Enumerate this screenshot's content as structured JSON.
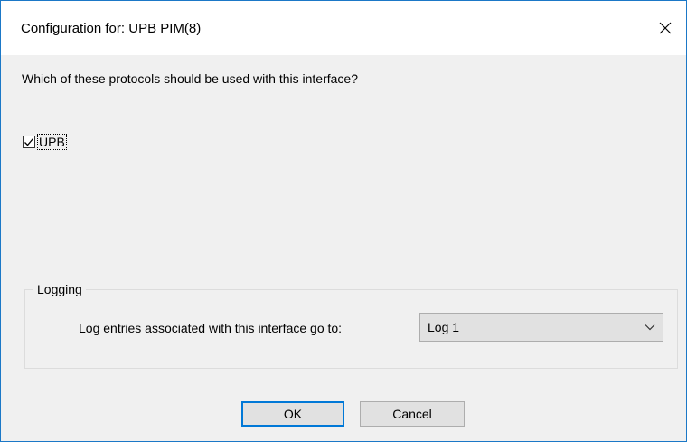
{
  "window": {
    "title": "Configuration for: UPB PIM(8)",
    "close_icon": "close-icon"
  },
  "protocols": {
    "question": "Which of these protocols should be used with this interface?",
    "items": [
      {
        "label": "UPB",
        "checked": true
      }
    ]
  },
  "logging": {
    "group_label": "Logging",
    "field_label": "Log entries associated with this interface go to:",
    "selected": "Log 1",
    "dropdown_icon": "chevron-down-icon"
  },
  "buttons": {
    "ok_label": "OK",
    "cancel_label": "Cancel"
  },
  "colors": {
    "accent": "#0078d7",
    "window_border": "#1b78c7",
    "background": "#f0f0f0"
  }
}
